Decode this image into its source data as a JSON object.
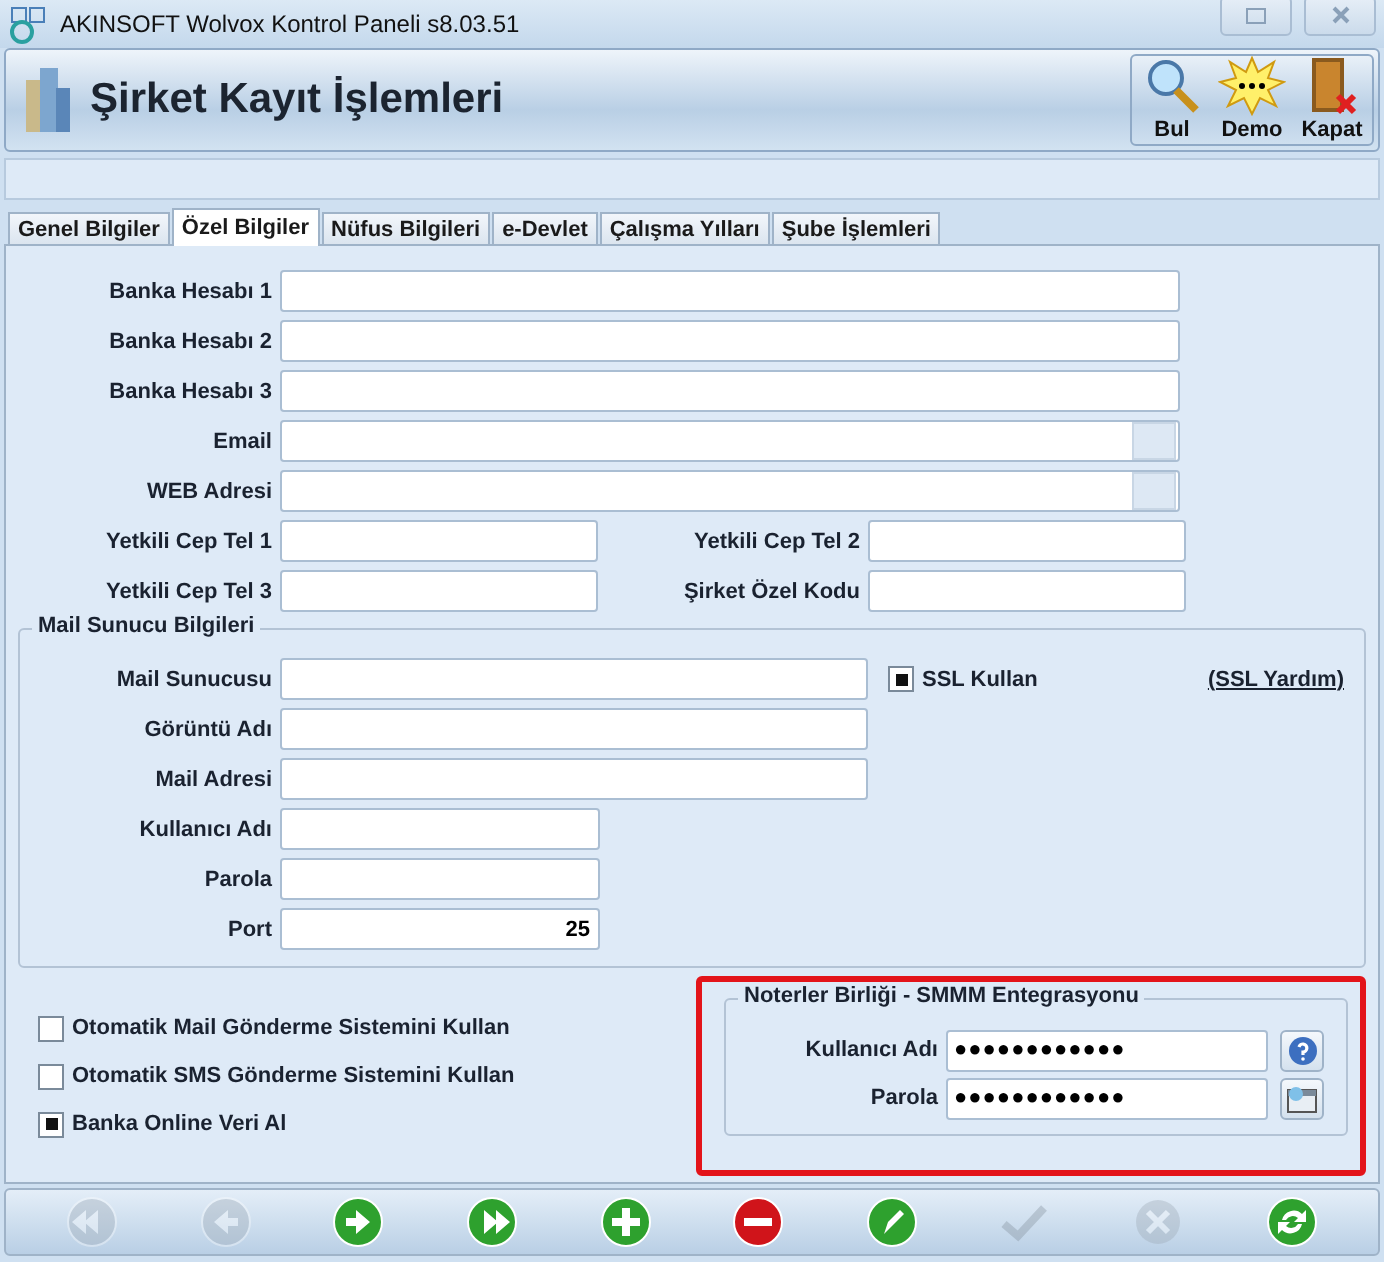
{
  "window": {
    "title": "AKINSOFT Wolvox Kontrol Paneli s8.03.51"
  },
  "header": {
    "title": "Şirket Kayıt İşlemleri",
    "buttons": [
      {
        "kind": "search",
        "label": "Bul"
      },
      {
        "kind": "demo",
        "label": "Demo"
      },
      {
        "kind": "exit",
        "label": "Kapat"
      }
    ]
  },
  "tabs": [
    {
      "label": "Genel Bilgiler",
      "selected": false
    },
    {
      "label": "Özel Bilgiler",
      "selected": true
    },
    {
      "label": "Nüfus Bilgileri",
      "selected": false
    },
    {
      "label": "e-Devlet",
      "selected": false
    },
    {
      "label": "Çalışma Yılları",
      "selected": false
    },
    {
      "label": "Şube İşlemleri",
      "selected": false
    }
  ],
  "fields": [
    {
      "label": "Banka Hesabı 1",
      "kind": "plain"
    },
    {
      "label": "Banka Hesabı 2",
      "kind": "plain"
    },
    {
      "label": "Banka Hesabı 3",
      "kind": "plain"
    },
    {
      "label": "Email",
      "kind": "button"
    },
    {
      "label": "WEB Adresi",
      "kind": "button"
    }
  ],
  "pair_fields": [
    {
      "label": "Yetkili Cep Tel 1"
    },
    {
      "label": "Yetkili Cep Tel 2"
    },
    {
      "label": "Yetkili Cep Tel 3"
    },
    {
      "label": "Şirket Özel Kodu"
    }
  ],
  "mail_server": {
    "title": "Mail Sunucu Bilgileri",
    "ssl": {
      "label": "SSL Kullan",
      "checked": true
    },
    "help_link": "(SSL Yardım)",
    "fields": [
      {
        "label": "Mail Sunucusu",
        "kind": "wide"
      },
      {
        "label": "Görüntü Adı",
        "kind": "wide"
      },
      {
        "label": "Mail Adresi",
        "kind": "wide"
      },
      {
        "label": "Kullanıcı Adı",
        "kind": "short"
      },
      {
        "label": "Parola",
        "kind": "short"
      },
      {
        "label": "Port",
        "kind": "short",
        "value": "25"
      }
    ]
  },
  "options": [
    {
      "label": "Otomatik Mail Gönderme Sistemini Kullan",
      "checked": false
    },
    {
      "label": "Otomatik SMS Gönderme Sistemini Kullan",
      "checked": false
    },
    {
      "label": "Banka Online Veri Al",
      "checked": true
    }
  ],
  "notary": {
    "title": "Noterler Birliği - SMMM Entegrasyonu",
    "highlighted": true,
    "fields": [
      {
        "label": "Kullanıcı Adı",
        "value": "●●●●●●●●●●●●",
        "kind": "help"
      },
      {
        "label": "Parola",
        "value": "●●●●●●●●●●●●",
        "kind": "picker"
      }
    ]
  },
  "toolbar": [
    {
      "kind": "first",
      "disabled": true
    },
    {
      "kind": "prev",
      "disabled": true
    },
    {
      "kind": "next",
      "disabled": false
    },
    {
      "kind": "last",
      "disabled": false
    },
    {
      "kind": "add",
      "disabled": false
    },
    {
      "kind": "delete",
      "disabled": false
    },
    {
      "kind": "edit",
      "disabled": false
    },
    {
      "kind": "save",
      "disabled": true
    },
    {
      "kind": "cancel",
      "disabled": true
    },
    {
      "kind": "refresh",
      "disabled": false
    }
  ]
}
